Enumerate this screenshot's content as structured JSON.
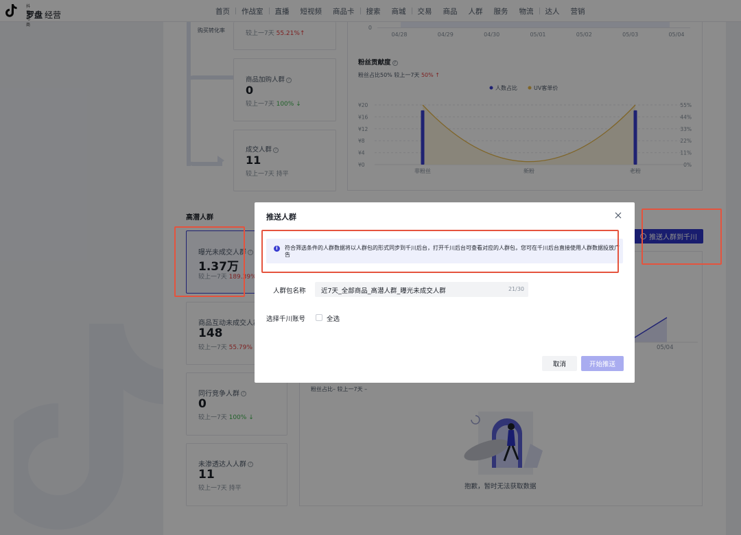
{
  "brand": {
    "sub": "抖音电商",
    "name": "罗盘",
    "name2": "经营"
  },
  "nav": [
    "首页",
    "作战室",
    "直播",
    "短视频",
    "商品卡",
    "搜索",
    "商城",
    "交易",
    "商品",
    "人群",
    "服务",
    "物流",
    "达人",
    "营销"
  ],
  "funnel": {
    "buy_rate_label": "购买转化率",
    "top_card": {
      "cmp_prefix": "较上一7天",
      "cmp_value": "55.21%",
      "cmp_arrow": "↑"
    },
    "cart_card": {
      "title": "商品加购人群",
      "value": "0",
      "cmp_prefix": "较上一7天",
      "cmp_value": "100%",
      "cmp_arrow": "↓"
    },
    "deal_card": {
      "title": "成交人群",
      "value": "11",
      "cmp_prefix": "较上一7天",
      "cmp_value": "持平"
    }
  },
  "top_chart": {
    "y_zero": "0",
    "dates": [
      "04/28",
      "04/29",
      "04/30",
      "05/01",
      "05/02",
      "05/03",
      "05/04"
    ]
  },
  "fans_chart": {
    "title": "粉丝贡献度",
    "subtitle_prefix": "粉丝占比50% 较上一7天",
    "subtitle_value": "50%",
    "subtitle_arrow": "↑"
  },
  "chart_data": {
    "type": "bar",
    "categories": [
      "非粉丝",
      "新粉",
      "老粉"
    ],
    "series": [
      {
        "name": "人数占比",
        "values": [
          50,
          0,
          50
        ],
        "color": "#3a3ed0"
      },
      {
        "name": "UV客单价",
        "values": [
          20,
          0,
          20
        ],
        "color": "#e8b84a",
        "render": "area"
      }
    ],
    "y_left_ticks": [
      "¥0",
      "¥4",
      "¥8",
      "¥12",
      "¥16",
      "¥20"
    ],
    "y_right_ticks": [
      "0%",
      "11%",
      "22%",
      "33%",
      "44%",
      "55%"
    ],
    "ylim_left": [
      0,
      20
    ],
    "ylim_right": [
      0,
      55
    ],
    "legend_position": "top-center",
    "grid": true
  },
  "potential": {
    "section_title": "高潜人群",
    "push_button": "推送人群到千川",
    "cards": [
      {
        "title": "曝光未成交人群",
        "value": "1.37万",
        "cmp_prefix": "较上一7天",
        "cmp_value": "189.39%",
        "dir": "up"
      },
      {
        "title": "商品互动未成交人群",
        "value": "148",
        "cmp_prefix": "较上一7天",
        "cmp_value": "55.79%",
        "dir": "up"
      },
      {
        "title": "同行竞争人群",
        "value": "0",
        "cmp_prefix": "较上一7天",
        "cmp_value": "100%",
        "dir": "down",
        "arrow": "↓"
      },
      {
        "title": "未渗透达人人群",
        "value": "11",
        "cmp_prefix": "较上一7天",
        "cmp_value": "持平",
        "dir": "flat"
      }
    ],
    "lower_panel": {
      "subtitle": "粉丝占比– 较上一7天 –",
      "axis_date": "05/04",
      "empty_text": "抱歉，暂时无法获取数据"
    }
  },
  "modal": {
    "title": "推送人群",
    "info_icon": "i",
    "info": "符合筛选条件的人群数据将以人群包的形式同步到千川后台，打开千川后台可查看对应的人群包，您可在千川后台直接使用人群数据投放广告",
    "name_label": "人群包名称",
    "name_value": "近7天_全部商品_高潜人群_曝光未成交人群",
    "name_count": "21/30",
    "account_label": "选择千川账号",
    "select_all": "全选",
    "cancel": "取消",
    "start": "开始推送"
  }
}
